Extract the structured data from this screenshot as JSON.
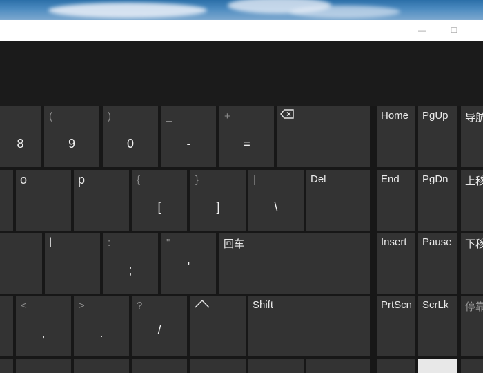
{
  "window": {
    "minimize_glyph": "—",
    "maximize_glyph": "☐"
  },
  "keys": {
    "eight": {
      "main": "8"
    },
    "nine": {
      "top": "(",
      "main": "9"
    },
    "zero": {
      "top": ")",
      "main": "0"
    },
    "minus": {
      "top": "_",
      "main": "-"
    },
    "equals": {
      "top": "+",
      "main": "="
    },
    "backspace": {
      "icon": "backspace-icon"
    },
    "o": {
      "label": "o"
    },
    "p": {
      "label": "p"
    },
    "lbracket": {
      "top": "{",
      "main": "["
    },
    "rbracket": {
      "top": "}",
      "main": "]"
    },
    "backslash": {
      "top": "|",
      "main": "\\"
    },
    "del": {
      "label": "Del"
    },
    "l": {
      "label": "l"
    },
    "semicolon": {
      "top": ":",
      "main": ";"
    },
    "quote": {
      "top": "\"",
      "main": "'"
    },
    "enter": {
      "label": "回车"
    },
    "comma": {
      "top": "<",
      "main": ","
    },
    "period": {
      "top": ">",
      "main": "."
    },
    "slash": {
      "top": "?",
      "main": "/"
    },
    "up": {
      "icon": "arrow-up-icon"
    },
    "shift": {
      "label": "Shift"
    },
    "home": {
      "label": "Home"
    },
    "pgup": {
      "label": "PgUp"
    },
    "nav": {
      "label": "导航"
    },
    "end": {
      "label": "End"
    },
    "pgdn": {
      "label": "PgDn"
    },
    "moveup": {
      "label": "上移"
    },
    "insert": {
      "label": "Insert"
    },
    "pause": {
      "label": "Pause"
    },
    "movedown": {
      "label": "下移"
    },
    "prtscn": {
      "label": "PrtScn"
    },
    "scrlk": {
      "label": "ScrLk"
    },
    "dock": {
      "label": "停靠"
    }
  }
}
